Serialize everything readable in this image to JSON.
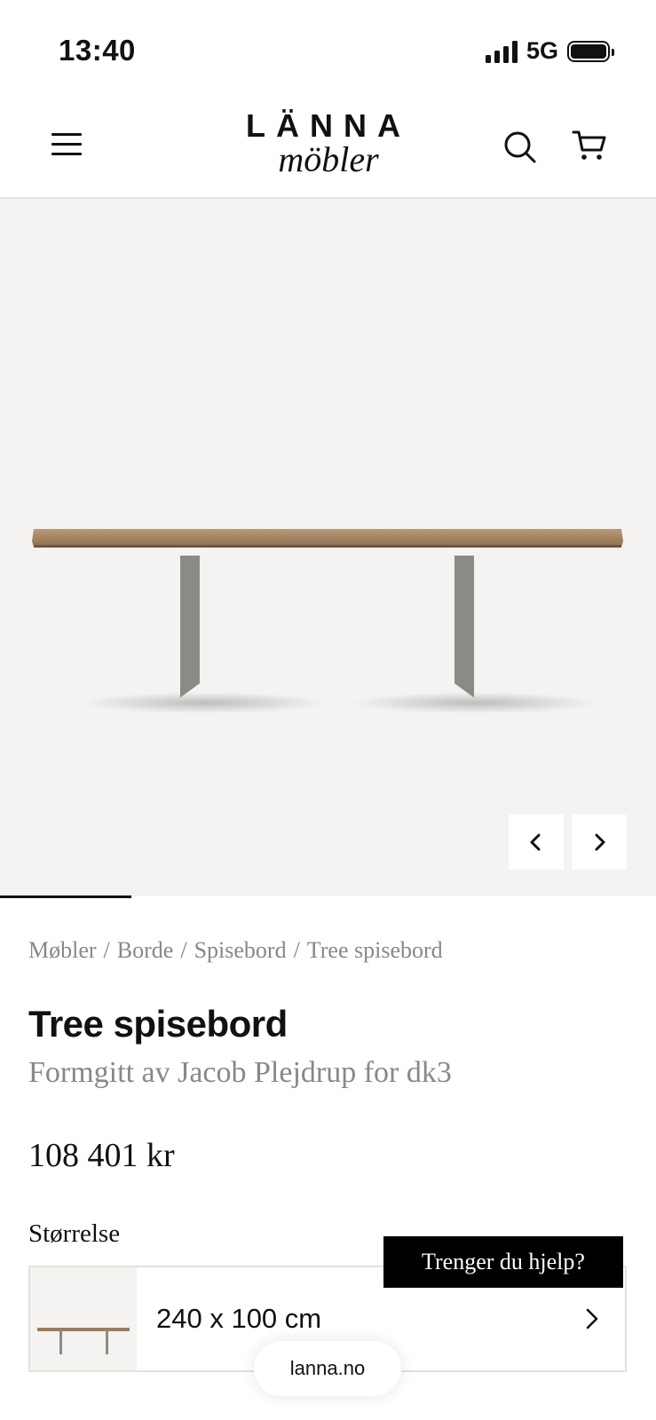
{
  "status_bar": {
    "time": "13:40",
    "network": "5G",
    "icons": [
      "signal-icon",
      "battery-icon"
    ]
  },
  "header": {
    "logo_top": "LÄNNA",
    "logo_bottom": "möbler",
    "icons": [
      "menu-icon",
      "search-icon",
      "cart-icon"
    ]
  },
  "gallery": {
    "image": "table-product-image",
    "current_slide": 1,
    "icons": [
      "chevron-left-icon",
      "chevron-right-icon"
    ]
  },
  "breadcrumb": {
    "items": [
      "Møbler",
      "Borde",
      "Spisebord",
      "Tree spisebord"
    ],
    "separator": "/"
  },
  "product": {
    "title": "Tree spisebord",
    "subtitle": "Formgitt av Jacob Plejdrup for dk3",
    "price": "108 401 kr",
    "size_label": "Størrelse",
    "selected_size": "240 x 100 cm"
  },
  "help_button": {
    "label": "Trenger du hjelp?"
  },
  "browser": {
    "url": "lanna.no"
  },
  "colors": {
    "accent": "#000000",
    "muted_text": "#8a8884",
    "border": "#e4e1d8",
    "image_bg": "#f4f3f1",
    "wood": "#a0805f"
  }
}
